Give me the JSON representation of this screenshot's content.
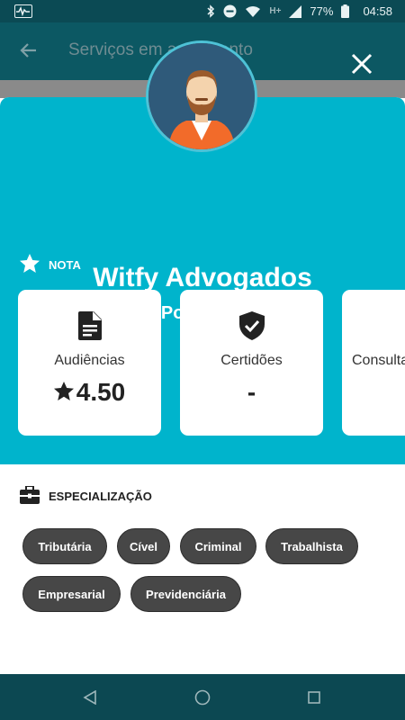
{
  "status_bar": {
    "network": "H+",
    "battery": "77%",
    "time": "04:58"
  },
  "app_bar": {
    "title": "Serviços em andamento"
  },
  "profile": {
    "name": "Witfy Advogados",
    "city": "Porto Alegre"
  },
  "rating": {
    "heading": "NOTA",
    "cards": [
      {
        "icon": "document-icon",
        "label": "Audiências",
        "value": "4.50",
        "has_star": true
      },
      {
        "icon": "shield-check-icon",
        "label": "Certidões",
        "value": "-",
        "has_star": false
      },
      {
        "icon": "",
        "label": "Consultas",
        "value": "",
        "has_star": false
      }
    ]
  },
  "specialization": {
    "heading": "ESPECIALIZAÇÃO",
    "chips": [
      "Tributária",
      "Cível",
      "Criminal",
      "Trabalhista",
      "Empresarial",
      "Previdenciária"
    ]
  },
  "colors": {
    "accent": "#00b4cc",
    "chip": "#474747",
    "status_bar": "#0b4a54",
    "nav_bar": "#0c4852"
  }
}
